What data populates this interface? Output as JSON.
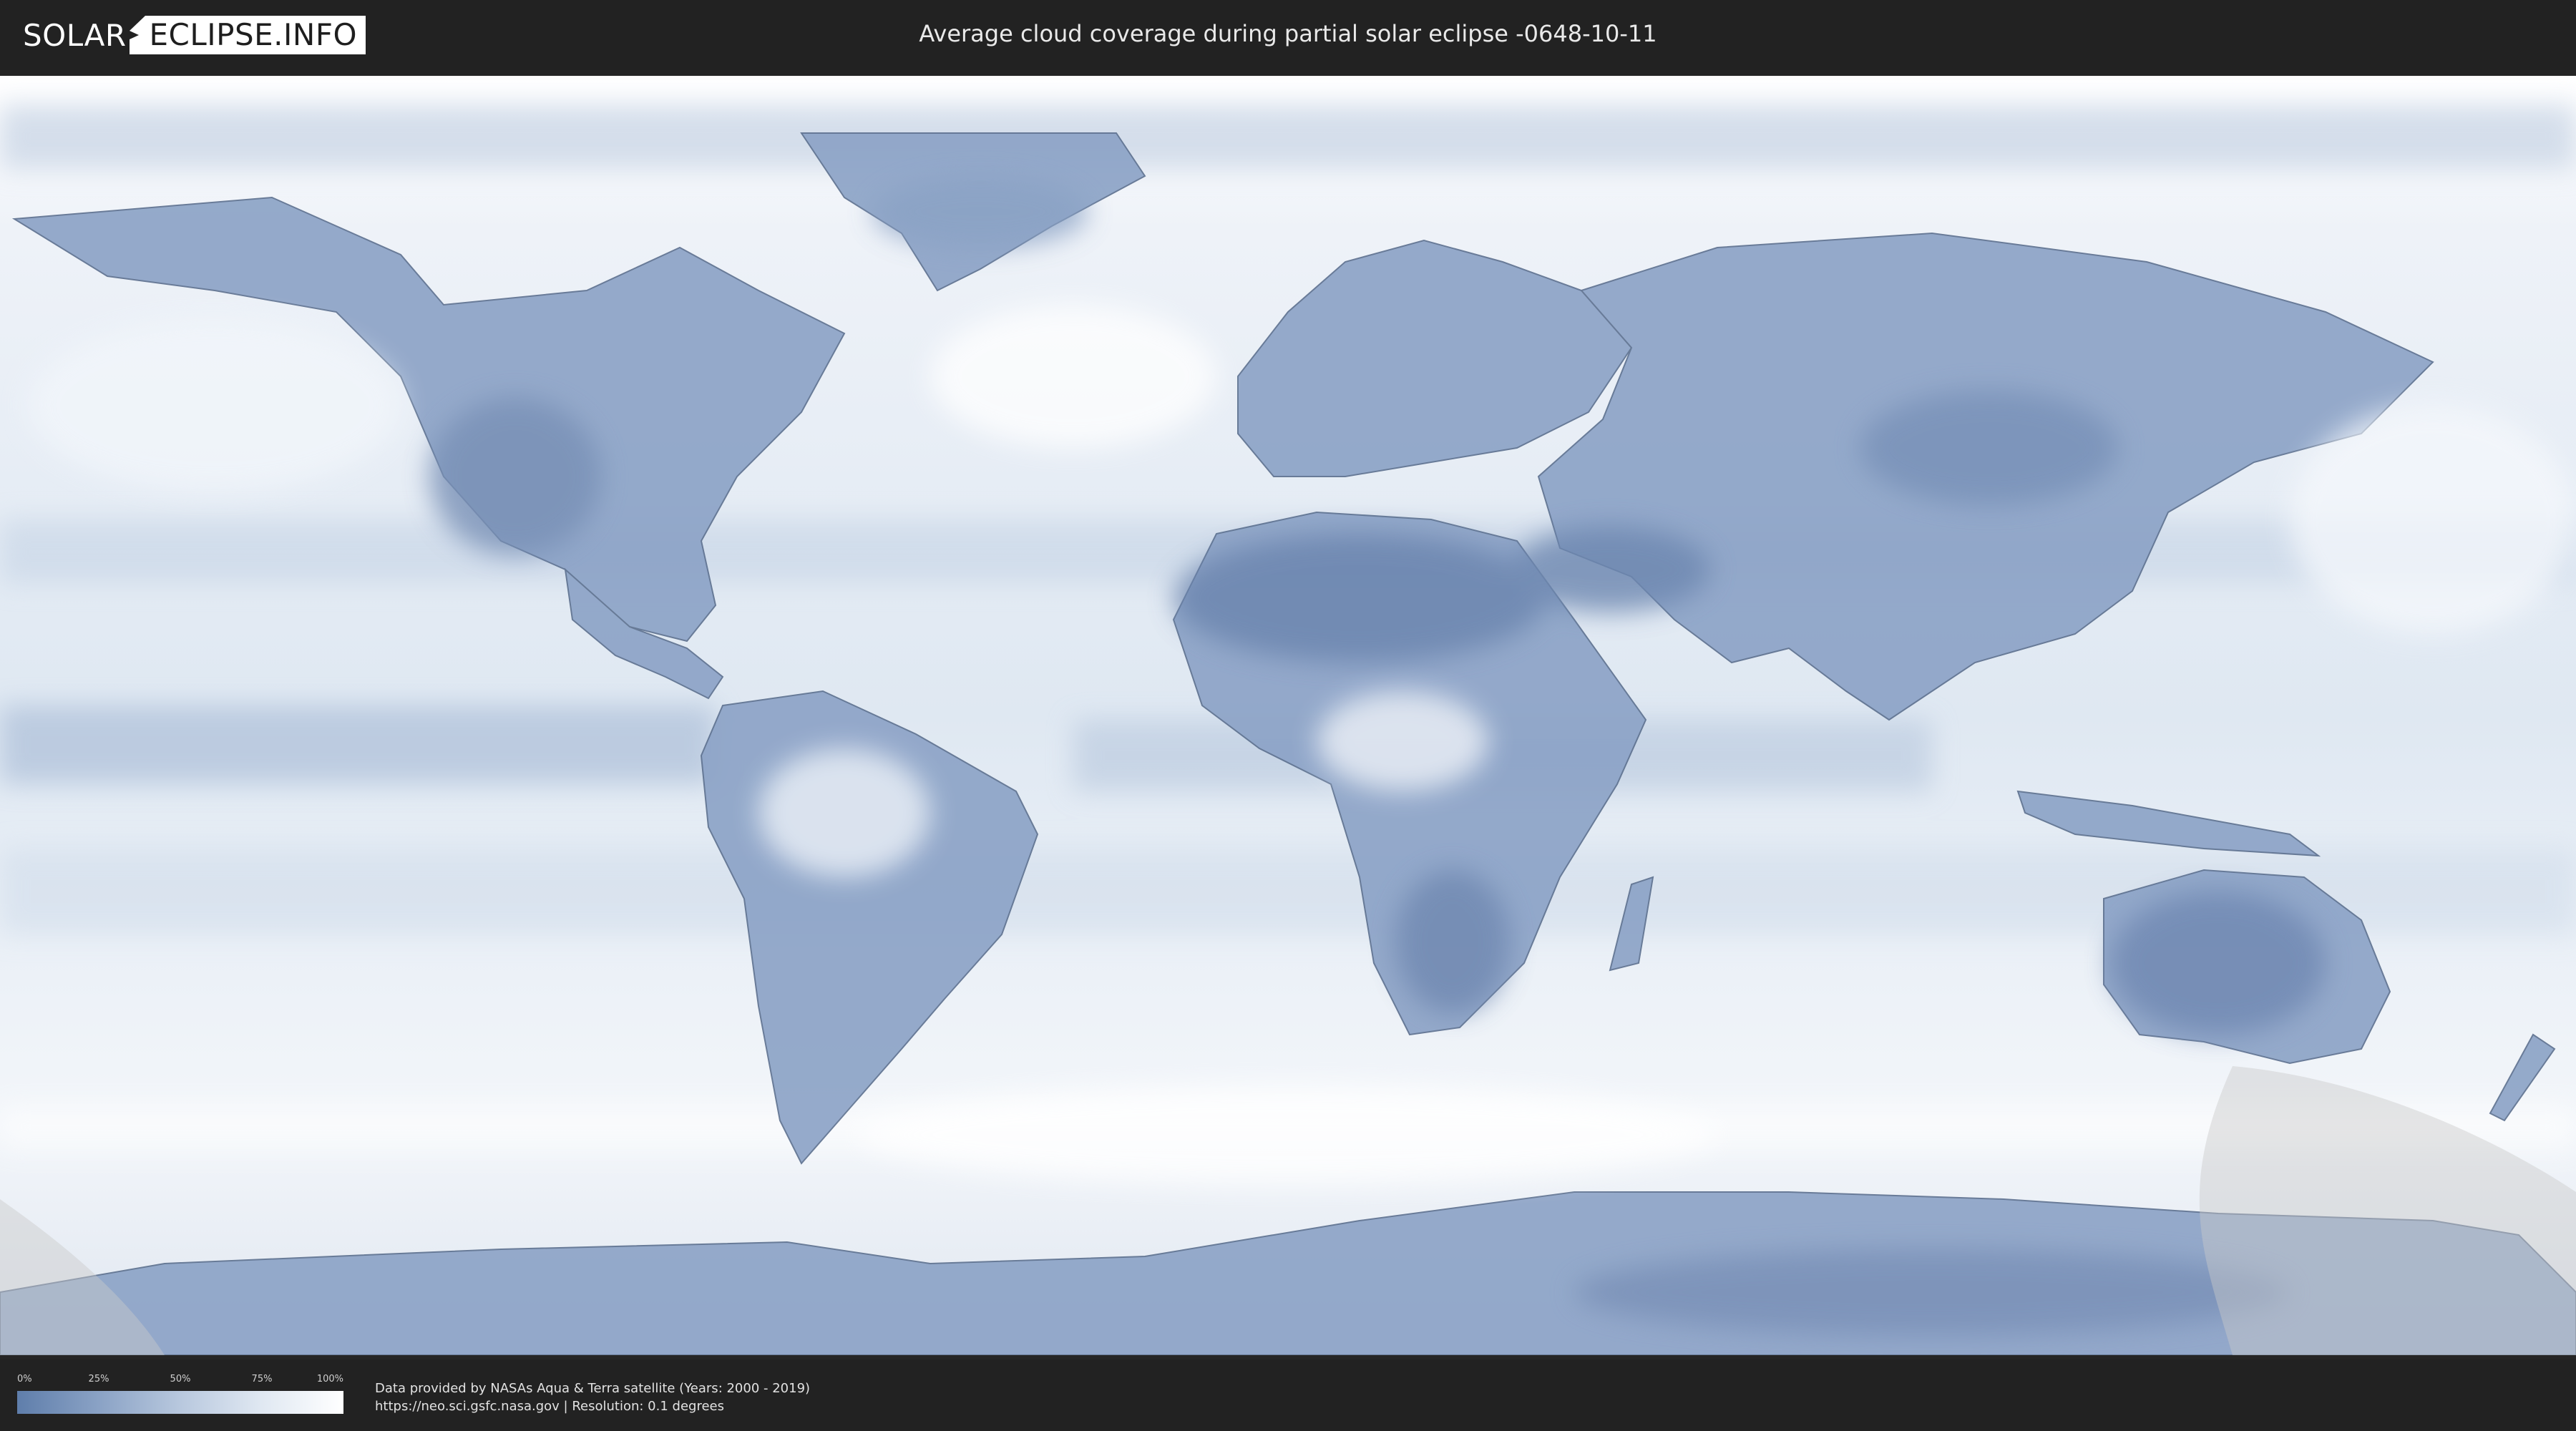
{
  "header": {
    "logo_left": "SOLAR",
    "logo_right": "ECLIPSE.INFO",
    "title": "Average cloud coverage during partial solar eclipse -0648-10-11"
  },
  "legend": {
    "ticks": [
      "0%",
      "25%",
      "50%",
      "75%",
      "100%"
    ],
    "colors": [
      "#5f7eab",
      "#8aa2c5",
      "#b8c8de",
      "#e0e8f2",
      "#ffffff"
    ]
  },
  "credits": {
    "line1": "Data provided by NASAs Aqua & Terra satellite (Years: 2000 - 2019)",
    "line2": "https://neo.sci.gsfc.nasa.gov | Resolution: 0.1 degrees"
  },
  "map": {
    "ocean_color": "#e6edf5",
    "land_color": "#7e96bd",
    "eclipse_region_color": "#c9c9c9"
  }
}
